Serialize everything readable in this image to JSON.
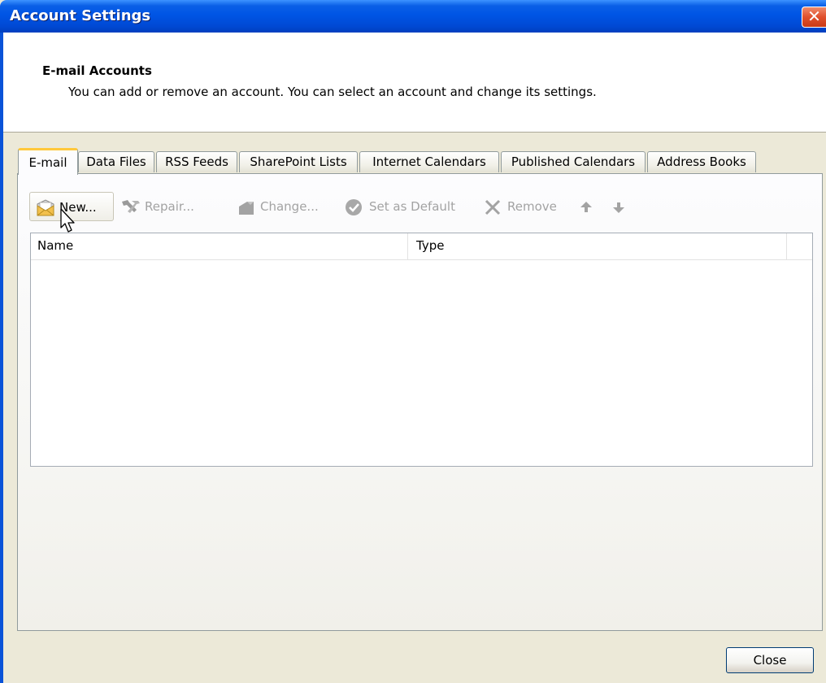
{
  "window": {
    "title": "Account Settings",
    "close_glyph": "✕"
  },
  "header": {
    "title": "E-mail Accounts",
    "description": "You can add or remove an account. You can select an account and change its settings."
  },
  "tabs": [
    {
      "label": "E-mail",
      "active": true
    },
    {
      "label": "Data Files"
    },
    {
      "label": "RSS Feeds"
    },
    {
      "label": "SharePoint Lists"
    },
    {
      "label": "Internet Calendars"
    },
    {
      "label": "Published Calendars"
    },
    {
      "label": "Address Books"
    }
  ],
  "toolbar": {
    "new_label": "New...",
    "repair_label": "Repair...",
    "change_label": "Change...",
    "set_default_label": "Set as Default",
    "remove_label": "Remove",
    "icons": [
      "new-mail-icon",
      "repair-icon",
      "change-icon",
      "set-default-icon",
      "remove-icon",
      "move-up-icon",
      "move-down-icon"
    ]
  },
  "list": {
    "columns": [
      "Name",
      "Type"
    ],
    "rows": []
  },
  "footer": {
    "close_label": "Close"
  },
  "colors": {
    "titlebar": "#0055e5",
    "active_tab_accent": "#ffc83c",
    "dialog_bg": "#ece9d8"
  }
}
